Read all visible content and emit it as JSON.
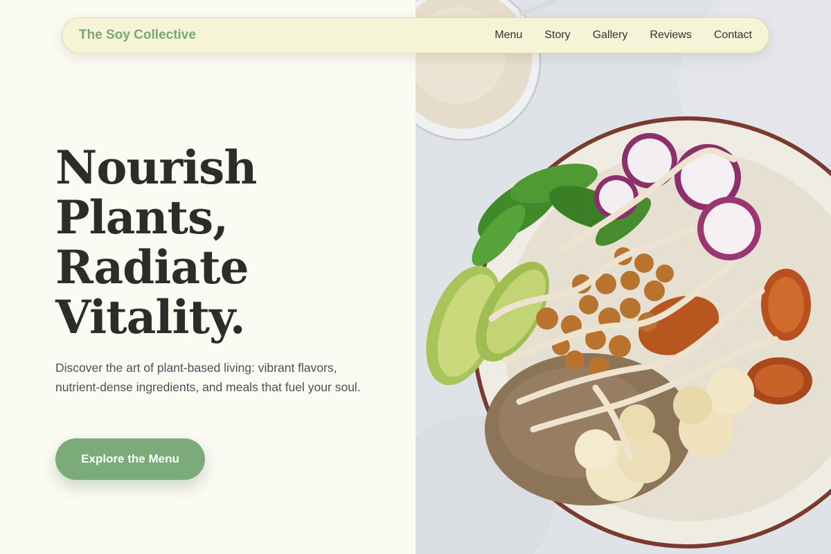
{
  "brand": {
    "name": "The Soy Collective"
  },
  "nav": {
    "items": [
      {
        "label": "Menu"
      },
      {
        "label": "Story"
      },
      {
        "label": "Gallery"
      },
      {
        "label": "Reviews"
      },
      {
        "label": "Contact"
      }
    ]
  },
  "hero": {
    "headline_lines": [
      "Nourish",
      "Plants,",
      "Radiate",
      "Vitality."
    ],
    "subtext": "Discover the art of plant-based living: vibrant flavors, nutrient-dense ingredients, and meals that fuel your soul.",
    "cta_label": "Explore the Menu",
    "image_subject": "buddha-bowl-photo"
  },
  "colors": {
    "background": "#fbfaf3",
    "navbar": "#f5f4d6",
    "brand": "#7aa67a",
    "cta": "#7aab79",
    "headline": "#2c2c2a",
    "body_text": "#4a5058"
  }
}
